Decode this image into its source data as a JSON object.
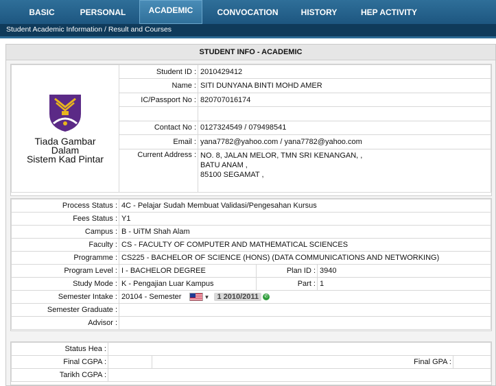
{
  "nav": {
    "tabs": [
      {
        "label": "BASIC"
      },
      {
        "label": "PERSONAL"
      },
      {
        "label": "ACADEMIC"
      },
      {
        "label": "CONVOCATION"
      },
      {
        "label": "HISTORY"
      },
      {
        "label": "HEP ACTIVITY"
      }
    ],
    "active_tab": "ACADEMIC",
    "breadcrumb": "Student Academic Information / Result and Courses"
  },
  "panel": {
    "title": "STUDENT INFO - ACADEMIC"
  },
  "photo": {
    "no_image_text_1": "Tiada Gambar",
    "no_image_text_2": "Dalam",
    "no_image_text_3": "Sistem Kad Pintar"
  },
  "profile": {
    "student_id_label": "Student ID :",
    "student_id": "2010429412",
    "name_label": "Name :",
    "name": "SITI DUNYANA BINTI MOHD AMER",
    "ic_label": "IC/Passport No :",
    "ic": "820707016174",
    "contact_label": "Contact No :",
    "contact": "0127324549 / 079498541",
    "email_label": "Email :",
    "email": "yana7782@yahoo.com / yana7782@yahoo.com",
    "address_label": "Current Address :",
    "address_1": "NO. 8, JALAN MELOR, TMN SRI KENANGAN, ,",
    "address_2": "BATU ANAM ,",
    "address_3": "85100 SEGAMAT ,"
  },
  "academic": {
    "process_status_label": "Process Status :",
    "process_status": "4C - Pelajar Sudah Membuat Validasi/Pengesahan Kursus",
    "fees_status_label": "Fees Status :",
    "fees_status": "Y1",
    "campus_label": "Campus :",
    "campus": "B - UiTM Shah Alam",
    "faculty_label": "Faculty :",
    "faculty": "CS - FACULTY OF COMPUTER AND MATHEMATICAL SCIENCES",
    "programme_label": "Programme :",
    "programme": "CS225 - BACHELOR OF SCIENCE (HONS) (DATA COMMUNICATIONS AND NETWORKING)",
    "program_level_label": "Program Level :",
    "program_level": "I - BACHELOR DEGREE",
    "plan_id_label": "Plan ID :",
    "plan_id": "3940",
    "study_mode_label": "Study Mode :",
    "study_mode": "K - Pengajian Luar Kampus",
    "part_label": "Part :",
    "part": "1",
    "semester_intake_label": "Semester Intake :",
    "semester_intake": "20104 - Semester",
    "semester_badge": "1 2010/2011",
    "semester_graduate_label": "Semester Graduate :",
    "semester_graduate": "",
    "advisor_label": "Advisor :",
    "advisor": ""
  },
  "results": {
    "status_hea_label": "Status Hea :",
    "status_hea": "",
    "final_cgpa_label": "Final CGPA :",
    "final_cgpa": "",
    "final_gpa_label": "Final GPA :",
    "final_gpa": "",
    "tarikh_cgpa_label": "Tarikh CGPA :",
    "tarikh_cgpa": ""
  },
  "colors": {
    "nav_bg": "#1d5680",
    "subbar_bg": "#0f3a5a",
    "panel_bg": "#f3f3f3"
  }
}
